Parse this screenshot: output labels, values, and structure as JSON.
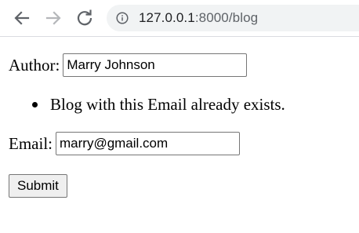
{
  "browser": {
    "url_host": "127.0.0.1",
    "url_rest": ":8000/blog"
  },
  "form": {
    "author_label": "Author:",
    "author_value": "Marry Johnson",
    "errors": [
      "Blog with this Email already exists."
    ],
    "email_label": "Email:",
    "email_value": "marry@gmail.com",
    "submit_label": "Submit"
  },
  "icons": {
    "back": "arrow-left-icon",
    "forward": "arrow-right-icon",
    "reload": "reload-icon",
    "site_info": "info-icon"
  },
  "colors": {
    "omnibox_bg": "#f1f3f4",
    "icon": "#5f6368",
    "icon_disabled": "#b5b7ba"
  }
}
